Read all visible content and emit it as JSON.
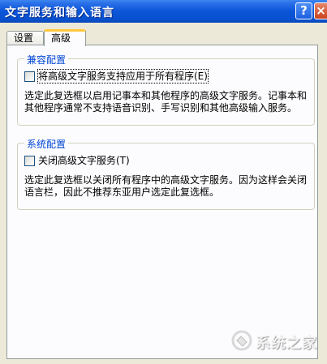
{
  "window": {
    "title": "文字服务和输入语言",
    "help_label": "?",
    "close_label": "×"
  },
  "tabs": [
    {
      "label": "设置",
      "active": false
    },
    {
      "label": "高级",
      "active": true
    }
  ],
  "compat_group": {
    "legend": "兼容配置",
    "checkbox_label": "将高级文字服务支持应用于所有程序(E)",
    "checked": false,
    "description": "选定此复选框以启用记事本和其他程序的高级文字服务。记事本和其他程序通常不支持语音识别、手写识别和其他高级输入服务。"
  },
  "system_group": {
    "legend": "系统配置",
    "checkbox_label": "关闭高级文字服务(T)",
    "checked": false,
    "description": "选定此复选框以关闭所有程序中的高级文字服务。因为这样会关闭语言栏，因此不推荐东亚用户选定此复选框。"
  },
  "watermark": {
    "text": "系统之家"
  },
  "colors": {
    "titlebar": "#0a55d8",
    "legend": "#0046d5",
    "tab_highlight": "#ffc83c"
  }
}
